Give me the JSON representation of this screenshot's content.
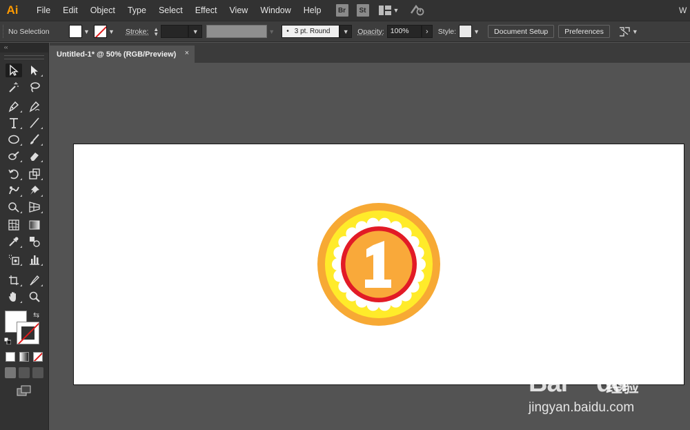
{
  "app": {
    "logo": "Ai",
    "right_partial": "W"
  },
  "menu": [
    "File",
    "Edit",
    "Object",
    "Type",
    "Select",
    "Effect",
    "View",
    "Window",
    "Help"
  ],
  "bridge": {
    "br": "Br",
    "st": "St"
  },
  "control": {
    "selection": "No Selection",
    "stroke_label": "Stroke:",
    "brush_label": "3 pt. Round",
    "opacity_label": "Opacity:",
    "opacity_value": "100%",
    "style_label": "Style:",
    "document_setup": "Document Setup",
    "preferences": "Preferences"
  },
  "tab": {
    "title": "Untitled-1* @ 50% (RGB/Preview)",
    "close": "×"
  },
  "panel": {
    "collapse": "‹‹"
  },
  "artwork": {
    "medal_number": "1",
    "colors": {
      "outer": "#f7a934",
      "ring": "#ffeb2a",
      "petals": "#ffffff",
      "red": "#e21b26",
      "inner": "#f9a93a"
    }
  },
  "watermark": {
    "main": "Bai",
    "main2": "du",
    "cn": "经验",
    "url": "jingyan.baidu.com"
  }
}
